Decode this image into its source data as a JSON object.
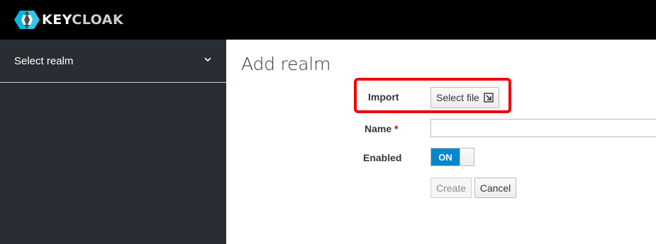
{
  "header": {
    "logo_key": "KEY",
    "logo_cloak": "CLOAK",
    "logo_icon": "keycloak-logo-icon"
  },
  "sidebar": {
    "realm_selector_label": "Select realm",
    "chevron_icon": "chevron-down-icon"
  },
  "main": {
    "title": "Add realm",
    "form": {
      "import_label": "Import",
      "select_file_label": "Select file",
      "select_file_icon": "file-import-icon",
      "name_label": "Name",
      "name_required_mark": "*",
      "name_value": "",
      "enabled_label": "Enabled",
      "enabled_toggle_text": "ON",
      "enabled": true,
      "create_label": "Create",
      "cancel_label": "Cancel"
    }
  },
  "colors": {
    "topbar": "#000000",
    "sidebar": "#292e34",
    "toggle_on": "#0088ce",
    "highlight": "#ee0000"
  }
}
